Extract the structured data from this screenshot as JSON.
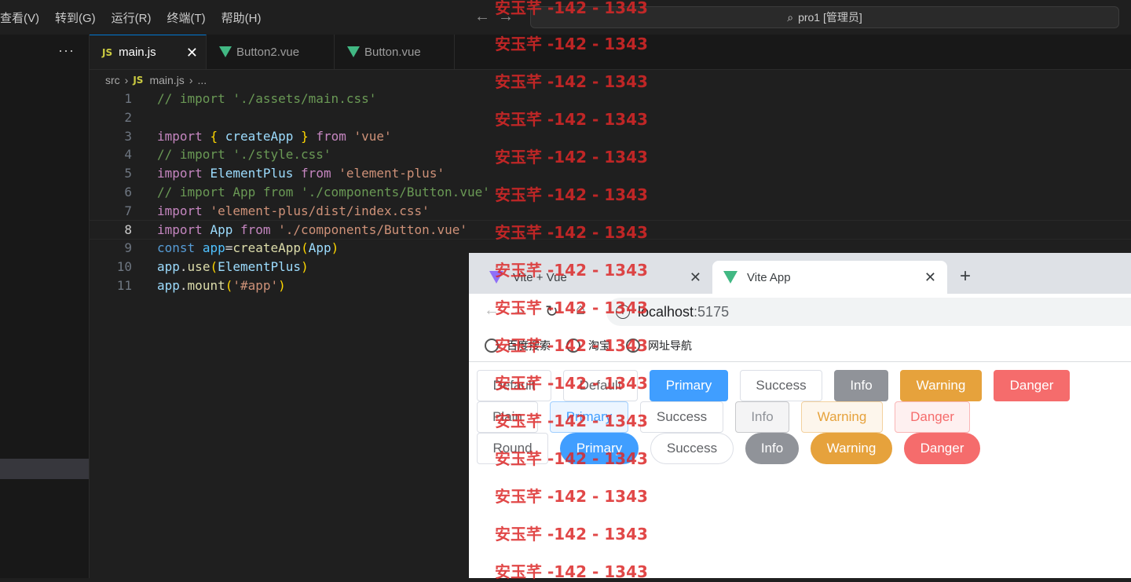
{
  "menu": [
    "查看(V)",
    "转到(G)",
    "运行(R)",
    "终端(T)",
    "帮助(H)"
  ],
  "command_center": "pro1 [管理员]",
  "sidebar_more": "···",
  "editor_tabs": [
    {
      "label": "main.js",
      "icon": "JS"
    },
    {
      "label": "Button2.vue",
      "icon": "vue-icon"
    },
    {
      "label": "Button.vue",
      "icon": "vue-icon"
    }
  ],
  "breadcrumb": {
    "folder": "src",
    "file": "main.js",
    "rest": "...",
    "icon": "JS"
  },
  "code_lines": [
    {
      "n": "1",
      "t": "// import './assets/main.css'"
    },
    {
      "n": "2",
      "t": ""
    },
    {
      "n": "3",
      "t": "import { createApp } from 'vue'"
    },
    {
      "n": "4",
      "t": "// import './style.css'"
    },
    {
      "n": "5",
      "t": "import ElementPlus from 'element-plus'"
    },
    {
      "n": "6",
      "t": "// import App from './components/Button.vue'"
    },
    {
      "n": "7",
      "t": "import 'element-plus/dist/index.css'"
    },
    {
      "n": "8",
      "t": "import App from './components/Button.vue'"
    },
    {
      "n": "9",
      "t": "const app=createApp(App)"
    },
    {
      "n": "10",
      "t": "app.use(ElementPlus)"
    },
    {
      "n": "11",
      "t": "app.mount('#app')"
    }
  ],
  "browser": {
    "tabs": [
      {
        "label": "Vite + Vue"
      },
      {
        "label": "Vite App"
      }
    ],
    "url_host": "localhost",
    "url_port": ":5175",
    "bookmarks": [
      "百度搜索",
      "淘宝",
      "网址导航"
    ]
  },
  "buttons": {
    "row1": [
      "Default",
      "Default",
      "Primary",
      "Success",
      "Info",
      "Warning",
      "Danger"
    ],
    "row2": [
      "Plain",
      "Primary",
      "Success",
      "Info",
      "Warning",
      "Danger"
    ],
    "row3": [
      "Round",
      "Primary",
      "Success",
      "Info",
      "Warning",
      "Danger"
    ]
  },
  "watermark": "安玉芊 -142 - 1343",
  "colors": {
    "primary": "#409eff",
    "success": "#67c23a",
    "info": "#909399",
    "warning": "#e6a23c",
    "danger": "#f56c6c"
  }
}
